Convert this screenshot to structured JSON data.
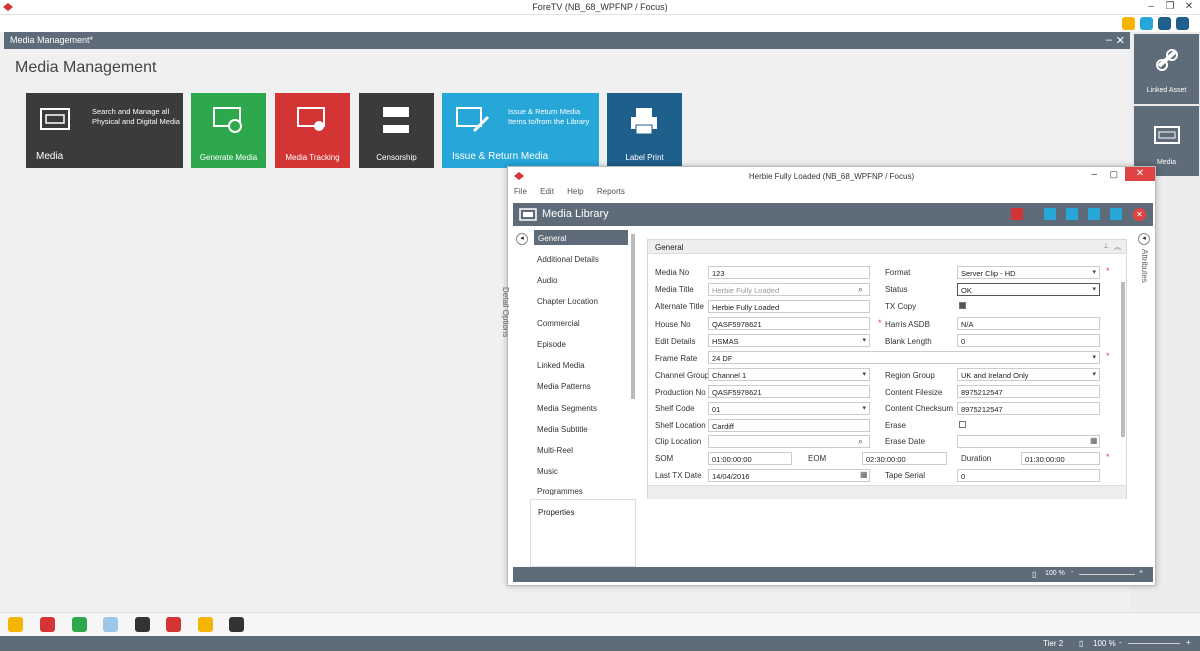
{
  "app": {
    "title": "ForeTV (NB_68_WPFNP / Focus)"
  },
  "window": {
    "title": "Media Management*",
    "heading": "Media Management"
  },
  "tiles": [
    {
      "label": "Media",
      "description": "Search and Manage all Physical and Digital Media",
      "color": "#3b3b3b"
    },
    {
      "label": "Generate Media",
      "color": "#2ea84c"
    },
    {
      "label": "Media Tracking",
      "color": "#d23534"
    },
    {
      "label": "Censorship",
      "color": "#3b3b3b"
    },
    {
      "label": "Issue & Return Media",
      "description": "Issue & Return Media Items to/from the Library",
      "color": "#27a6d8"
    },
    {
      "label": "Label Print",
      "color": "#1f5f8c"
    }
  ],
  "right_panel": [
    {
      "label": "Linked Asset"
    },
    {
      "label": "Media"
    }
  ],
  "dialog": {
    "title": "Herbie Fully Loaded (NB_68_WPFNP / Focus)",
    "menu": [
      "File",
      "Edit",
      "Help",
      "Reports"
    ],
    "heading": "Media Library",
    "detail_options": "Detail Options",
    "attributes": "Attributes",
    "sidebar": [
      "General",
      "Additional Details",
      "Audio",
      "Chapter Location",
      "Commercial",
      "Episode",
      "Linked Media",
      "Media Patterns",
      "Media Segments",
      "Media Subtitle",
      "Multi-Reel",
      "Music",
      "Programmes"
    ],
    "properties": "Properties",
    "section": "General",
    "zoom": "100 %",
    "fields": {
      "media_no": {
        "label": "Media No",
        "value": "123"
      },
      "media_title": {
        "label": "Media Title",
        "value": "Herbie Fully Loaded"
      },
      "alternate_title": {
        "label": "Alternate Title",
        "value": "Herbie Fully Loaded"
      },
      "house_no": {
        "label": "House No",
        "value": "QASF5978621"
      },
      "edit_details": {
        "label": "Edit Details",
        "value": "HSMAS"
      },
      "frame_rate": {
        "label": "Frame Rate",
        "value": "24 DF"
      },
      "channel_group": {
        "label": "Channel Group",
        "value": "Channel 1"
      },
      "production_no": {
        "label": "Production No",
        "value": "QASF5978621"
      },
      "shelf_code": {
        "label": "Shelf Code",
        "value": "01"
      },
      "shelf_location": {
        "label": "Shelf Location",
        "value": "Cardiff"
      },
      "clip_location": {
        "label": "Clip Location",
        "value": ""
      },
      "som": {
        "label": "SOM",
        "value": "01:00:00:00"
      },
      "eom": {
        "label": "EOM",
        "value": "02:30:00:00"
      },
      "duration": {
        "label": "Duration",
        "value": "01:30:00:00"
      },
      "last_tx_date": {
        "label": "Last TX Date",
        "value": "14/04/2016"
      },
      "format": {
        "label": "Format",
        "value": "Server Clip - HD"
      },
      "status": {
        "label": "Status",
        "value": "OK"
      },
      "tx_copy": {
        "label": "TX Copy",
        "checked": true
      },
      "harris_asdb": {
        "label": "Harris ASDB",
        "value": "N/A"
      },
      "blank_length": {
        "label": "Blank Length",
        "value": "0"
      },
      "region_group": {
        "label": "Region Group",
        "value": "UK and Ireland Only"
      },
      "content_filesize": {
        "label": "Content Filesize",
        "value": "8975212547"
      },
      "content_checksum": {
        "label": "Content Checksum",
        "value": "8975212547"
      },
      "erase": {
        "label": "Erase",
        "checked": false
      },
      "erase_date": {
        "label": "Erase Date",
        "value": ""
      },
      "tape_serial": {
        "label": "Tape Serial",
        "value": "0"
      }
    }
  },
  "footer": {
    "tier": "Tier 2",
    "zoom": "100 %"
  }
}
